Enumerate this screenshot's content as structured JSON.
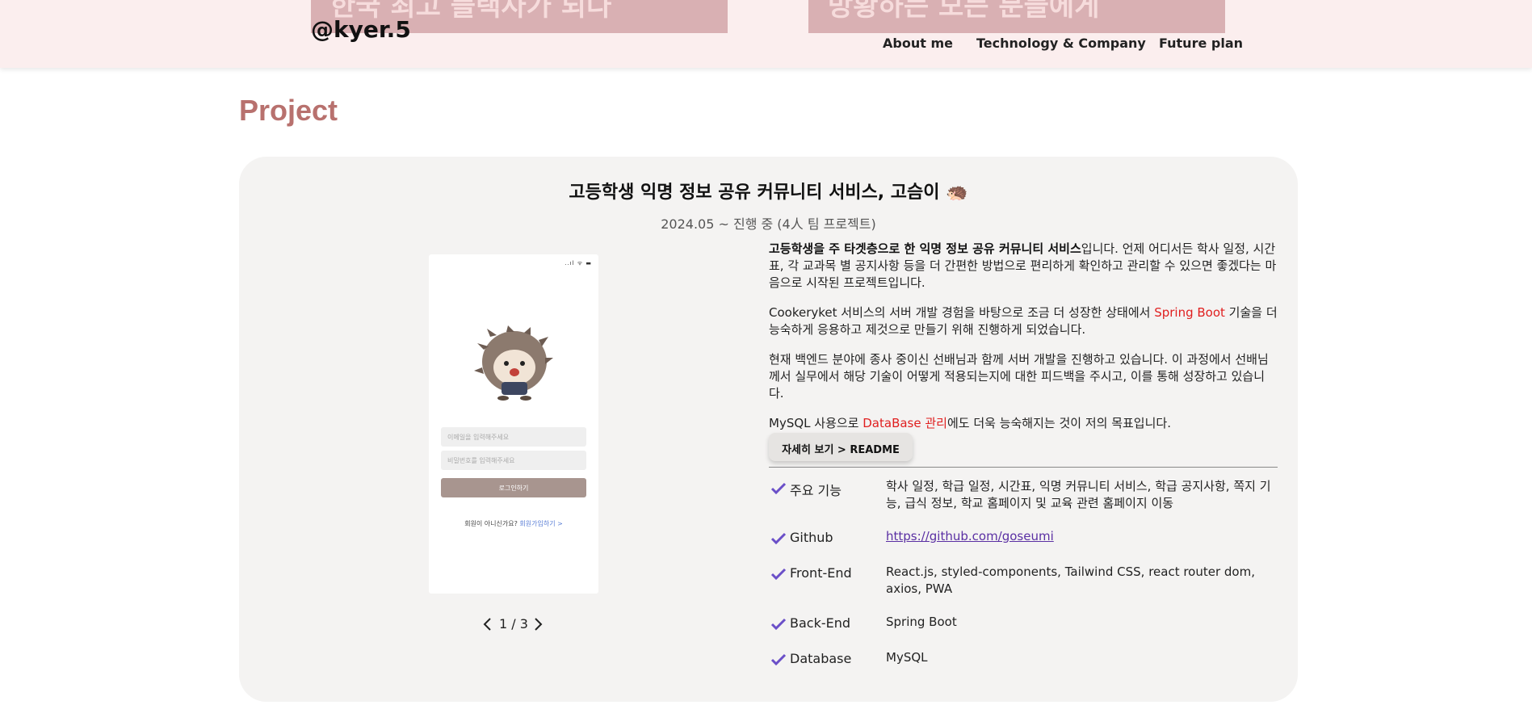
{
  "header": {
    "banner_left": "한국 최고 플랙사가 되다",
    "banner_right": "방황하는 모든 분들에게",
    "brand": "@kyer.5",
    "nav": {
      "about": "About me",
      "tech": "Technology & Company",
      "future": "Future plan"
    }
  },
  "section": {
    "title": "Project"
  },
  "project": {
    "title": "고등학생 익명 정보 공유 커뮤니티 서비스, 고슴이 🦔",
    "date": "2024.05 ~ 진행 중 (4人 팀 프로젝트)",
    "phone": {
      "status": "..ıl ᯤ ▬",
      "email_placeholder": "이메일을 입력해주세요",
      "password_placeholder": "비밀번호를 입력해주세요",
      "login_label": "로그인하기",
      "signup_prefix": "회원이 아니신가요?",
      "signup_link": "회원가입하기 >"
    },
    "pager": {
      "text": "1 / 3"
    },
    "description": {
      "p1_bold": "고등학생을 주 타겟층으로 한 익명 정보 공유 커뮤니티 서비스",
      "p1_rest": "입니다. 언제 어디서든 학사 일정, 시간표, 각 교과목 별 공지사항 등을 더 간편한 방법으로 편리하게 확인하고 관리할 수 있으면 좋겠다는 마음으로 시작된 프로젝트입니다.",
      "p2_before": "Cookeryket 서비스의 서버 개발 경험을 바탕으로 조금 더 성장한 상태에서 ",
      "p2_highlight": "Spring Boot",
      "p2_after": " 기술을 더 능숙하게 응용하고 제것으로 만들기 위해 진행하게 되었습니다.",
      "p3": "현재 백엔드 분야에 종사 중이신 선배님과 함께 서버 개발을 진행하고 있습니다. 이 과정에서 선배님께서 실무에서 해당 기술이 어떻게 적용되는지에 대한 피드백을 주시고, 이를 통해 성장하고 있습니다.",
      "p4_before": "MySQL 사용으로 ",
      "p4_highlight": "DataBase 관리",
      "p4_after": "에도 더욱 능숙해지는 것이 저의 목표입니다."
    },
    "readme_button": "자세히 보기 > README",
    "specs": [
      {
        "label": "주요 기능",
        "value": "학사 일정, 학급 일정, 시간표, 익명 커뮤니티 서비스, 학급 공지사항, 쪽지 기능, 급식 정보, 학교 홈페이지 및 교육 관련 홈페이지 이동"
      },
      {
        "label": "Github",
        "value": "https://github.com/goseumi"
      },
      {
        "label": "Front-End",
        "value": "React.js, styled-components, Tailwind CSS, react router dom, axios, PWA"
      },
      {
        "label": "Back-End",
        "value": "Spring Boot"
      },
      {
        "label": "Database",
        "value": "MySQL"
      }
    ]
  },
  "colors": {
    "accent": "#b8716e",
    "check": "#6a4fc8",
    "highlight": "#e01f1f",
    "card_bg": "#f4f3f2",
    "header_bg": "#fbeeee"
  },
  "icons": {
    "check": "check-icon",
    "prev": "chevron-left-icon",
    "next": "chevron-right-icon"
  }
}
